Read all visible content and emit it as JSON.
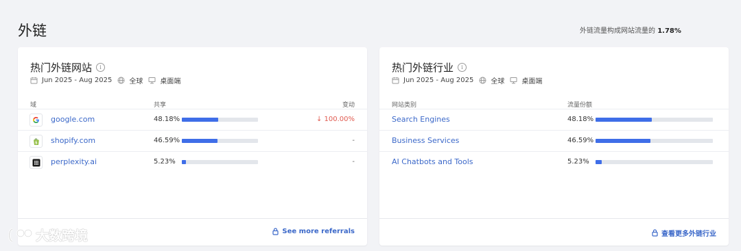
{
  "page": {
    "title": "外链",
    "summary_prefix": "外链流量构成网站流量的",
    "summary_value": "1.78%"
  },
  "left_card": {
    "title": "热门外链网站",
    "date_range": "Jun 2025 - Aug 2025",
    "region": "全球",
    "device": "桌面端",
    "columns": {
      "domain": "域",
      "share": "共享",
      "change": "变动"
    },
    "rows": [
      {
        "domain": "google.com",
        "share": "48.18%",
        "share_value": 48.18,
        "change": "↓ 100.00%",
        "icon": "google-icon"
      },
      {
        "domain": "shopify.com",
        "share": "46.59%",
        "share_value": 46.59,
        "change": "-",
        "icon": "shopify-icon"
      },
      {
        "domain": "perplexity.ai",
        "share": "5.23%",
        "share_value": 5.23,
        "change": "-",
        "icon": "perplexity-icon"
      }
    ],
    "footer_link": "See more referrals"
  },
  "right_card": {
    "title": "热门外链行业",
    "date_range": "Jun 2025 - Aug 2025",
    "region": "全球",
    "device": "桌面端",
    "columns": {
      "category": "网站类别",
      "share": "流量份额"
    },
    "rows": [
      {
        "category": "Search Engines",
        "share": "48.18%",
        "share_value": 48.18
      },
      {
        "category": "Business Services",
        "share": "46.59%",
        "share_value": 46.59
      },
      {
        "category": "AI Chatbots and Tools",
        "share": "5.23%",
        "share_value": 5.23
      }
    ],
    "footer_link": "查看更多外链行业"
  },
  "watermark": {
    "text": "大数跨境"
  },
  "colors": {
    "accent": "#3f6ee8",
    "link": "#3b68c9",
    "negative": "#e05a4f"
  }
}
